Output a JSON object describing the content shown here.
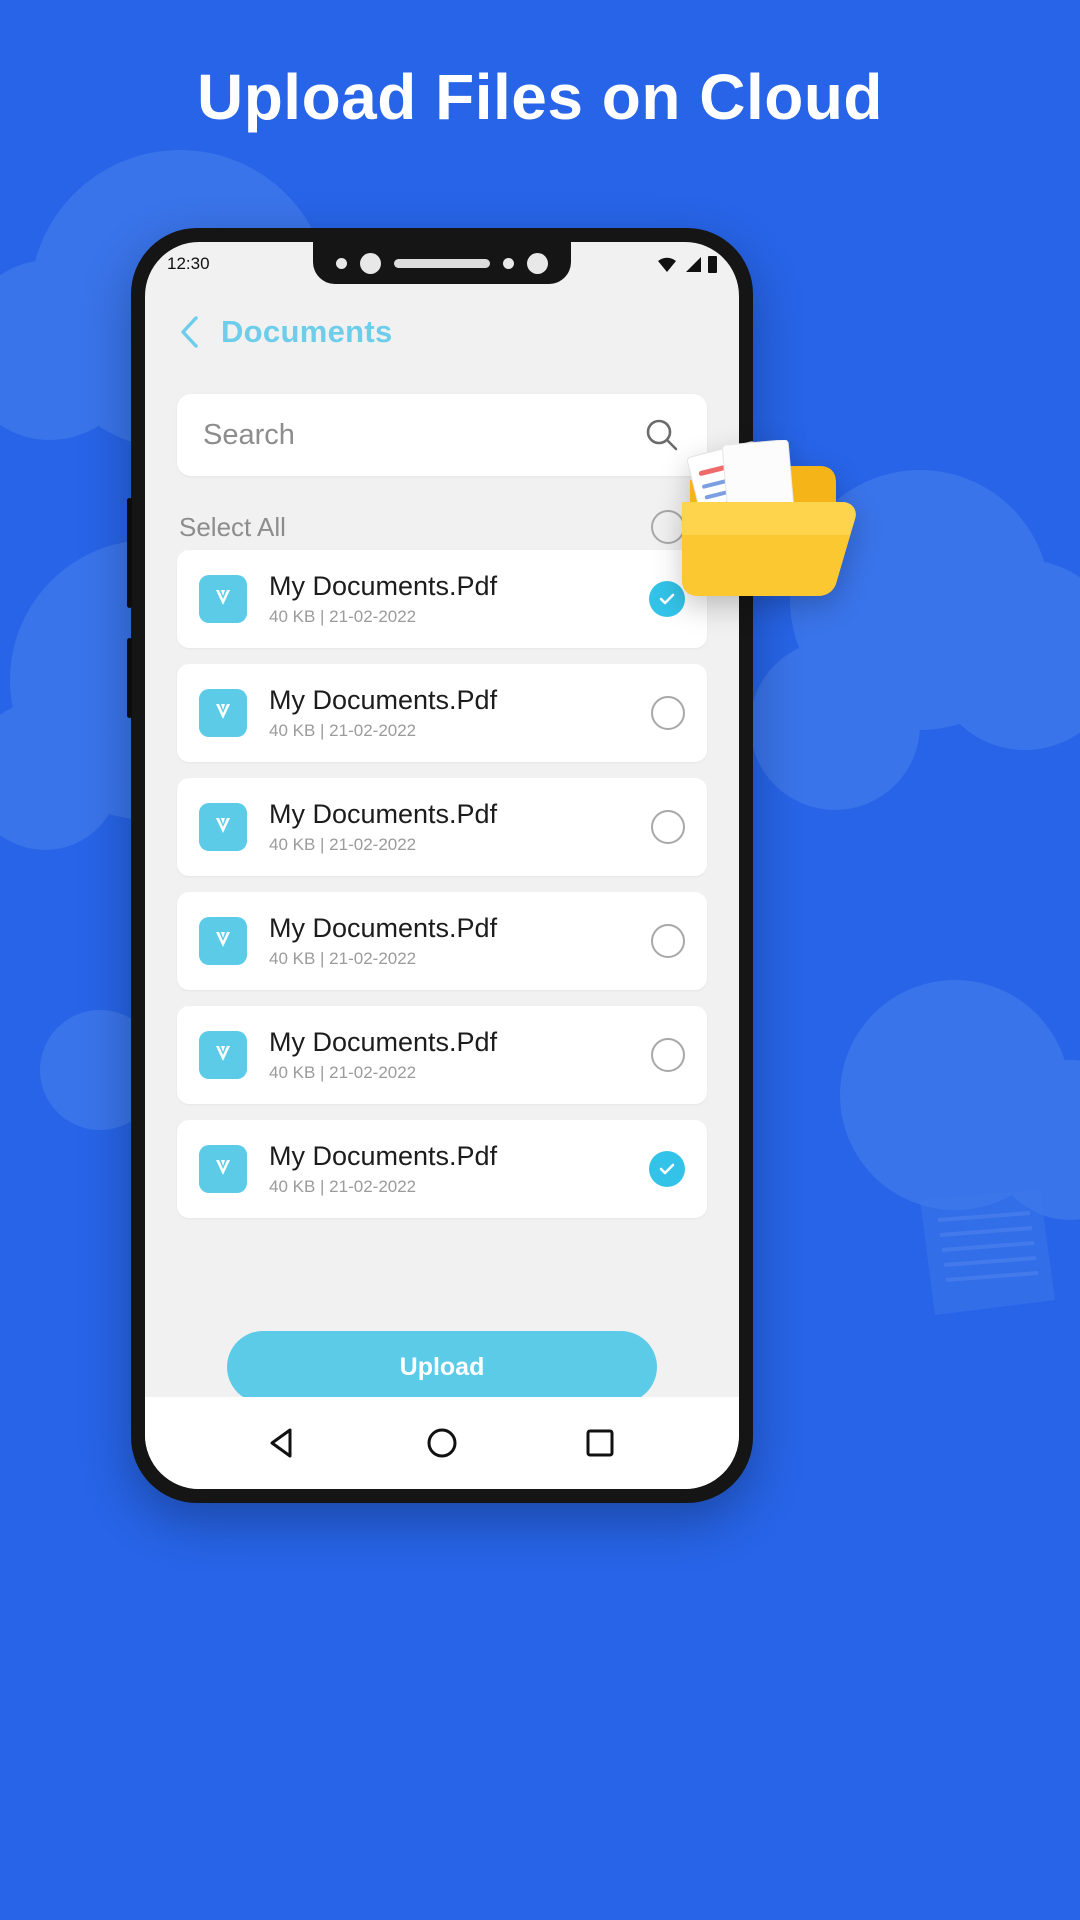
{
  "poster": {
    "headline": "Upload Files on Cloud",
    "background_color": "#2764e7",
    "accent_color": "#5ccbe8"
  },
  "phone": {
    "status_bar": {
      "time": "12:30",
      "icons": [
        "wifi-icon",
        "signal-icon",
        "battery-icon"
      ]
    },
    "nav_bar": {
      "back_label": "back-triangle-icon",
      "home_label": "home-circle-icon",
      "recents_label": "recents-square-icon"
    }
  },
  "app": {
    "header": {
      "back_icon": "chevron-left-icon",
      "title": "Documents",
      "title_color": "#6ecdea"
    },
    "search": {
      "placeholder": "Search",
      "value": "",
      "icon": "search-icon"
    },
    "select_all": {
      "label": "Select All",
      "checked": false
    },
    "files": [
      {
        "name": "My Documents.Pdf",
        "meta": "40 KB | 21-02-2022",
        "icon": "pdf-file-icon",
        "selected": true
      },
      {
        "name": "My Documents.Pdf",
        "meta": "40 KB | 21-02-2022",
        "icon": "pdf-file-icon",
        "selected": false
      },
      {
        "name": "My Documents.Pdf",
        "meta": "40 KB | 21-02-2022",
        "icon": "pdf-file-icon",
        "selected": false
      },
      {
        "name": "My Documents.Pdf",
        "meta": "40 KB | 21-02-2022",
        "icon": "pdf-file-icon",
        "selected": false
      },
      {
        "name": "My Documents.Pdf",
        "meta": "40 KB | 21-02-2022",
        "icon": "pdf-file-icon",
        "selected": false
      },
      {
        "name": "My Documents.Pdf",
        "meta": "40 KB | 21-02-2022",
        "icon": "pdf-file-icon",
        "selected": true
      }
    ],
    "upload_button": {
      "label": "Upload"
    }
  },
  "decorations": {
    "folder_illustration": "folder-with-documents-icon",
    "background_document": "document-outline-icon"
  }
}
